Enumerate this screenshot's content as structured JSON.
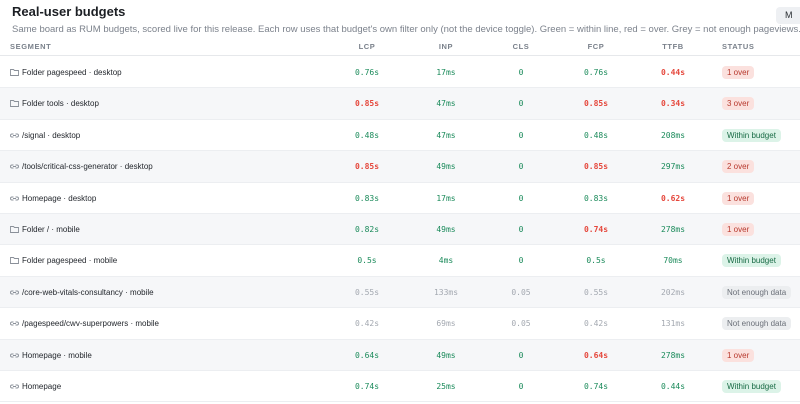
{
  "header": {
    "title": "Real-user budgets",
    "subtitle": "Same board as RUM budgets, scored live for this release. Each row uses that budget's own filter only (not the device toggle). Green = within line, red = over. Grey = not enough pageviews.",
    "corner_button": "M"
  },
  "table": {
    "columns": [
      "SEGMENT",
      "LCP",
      "INP",
      "CLS",
      "FCP",
      "TTFB",
      "STATUS"
    ],
    "rows": [
      {
        "icon": "folder-icon",
        "segment": "Folder pagespeed · desktop",
        "lcp": "0.76s",
        "lcp_s": "good",
        "inp": "17ms",
        "inp_s": "good",
        "cls": "0",
        "cls_s": "good",
        "fcp": "0.76s",
        "fcp_s": "good",
        "ttfb": "0.44s",
        "ttfb_s": "bad",
        "status": "1 over",
        "status_s": "bad"
      },
      {
        "icon": "folder-icon",
        "segment": "Folder tools · desktop",
        "lcp": "0.85s",
        "lcp_s": "bad",
        "inp": "47ms",
        "inp_s": "good",
        "cls": "0",
        "cls_s": "good",
        "fcp": "0.85s",
        "fcp_s": "bad",
        "ttfb": "0.34s",
        "ttfb_s": "bad",
        "status": "3 over",
        "status_s": "bad"
      },
      {
        "icon": "link-icon",
        "segment": "/signal · desktop",
        "lcp": "0.48s",
        "lcp_s": "good",
        "inp": "47ms",
        "inp_s": "good",
        "cls": "0",
        "cls_s": "good",
        "fcp": "0.48s",
        "fcp_s": "good",
        "ttfb": "208ms",
        "ttfb_s": "good",
        "status": "Within budget",
        "status_s": "good"
      },
      {
        "icon": "link-icon",
        "segment": "/tools/critical-css-generator · desktop",
        "lcp": "0.85s",
        "lcp_s": "bad",
        "inp": "49ms",
        "inp_s": "good",
        "cls": "0",
        "cls_s": "good",
        "fcp": "0.85s",
        "fcp_s": "bad",
        "ttfb": "297ms",
        "ttfb_s": "good",
        "status": "2 over",
        "status_s": "bad"
      },
      {
        "icon": "link-icon",
        "segment": "Homepage · desktop",
        "lcp": "0.83s",
        "lcp_s": "good",
        "inp": "17ms",
        "inp_s": "good",
        "cls": "0",
        "cls_s": "good",
        "fcp": "0.83s",
        "fcp_s": "good",
        "ttfb": "0.62s",
        "ttfb_s": "bad",
        "status": "1 over",
        "status_s": "bad"
      },
      {
        "icon": "folder-icon",
        "segment": "Folder / · mobile",
        "lcp": "0.82s",
        "lcp_s": "good",
        "inp": "49ms",
        "inp_s": "good",
        "cls": "0",
        "cls_s": "good",
        "fcp": "0.74s",
        "fcp_s": "bad",
        "ttfb": "278ms",
        "ttfb_s": "good",
        "status": "1 over",
        "status_s": "bad"
      },
      {
        "icon": "folder-icon",
        "segment": "Folder pagespeed · mobile",
        "lcp": "0.5s",
        "lcp_s": "good",
        "inp": "4ms",
        "inp_s": "good",
        "cls": "0",
        "cls_s": "good",
        "fcp": "0.5s",
        "fcp_s": "good",
        "ttfb": "70ms",
        "ttfb_s": "good",
        "status": "Within budget",
        "status_s": "good"
      },
      {
        "icon": "link-icon",
        "segment": "/core-web-vitals-consultancy · mobile",
        "lcp": "0.55s",
        "lcp_s": "none",
        "inp": "133ms",
        "inp_s": "none",
        "cls": "0.05",
        "cls_s": "none",
        "fcp": "0.55s",
        "fcp_s": "none",
        "ttfb": "202ms",
        "ttfb_s": "none",
        "status": "Not enough data",
        "status_s": "none"
      },
      {
        "icon": "link-icon",
        "segment": "/pagespeed/cwv-superpowers · mobile",
        "lcp": "0.42s",
        "lcp_s": "none",
        "inp": "69ms",
        "inp_s": "none",
        "cls": "0.05",
        "cls_s": "none",
        "fcp": "0.42s",
        "fcp_s": "none",
        "ttfb": "131ms",
        "ttfb_s": "none",
        "status": "Not enough data",
        "status_s": "none"
      },
      {
        "icon": "link-icon",
        "segment": "Homepage · mobile",
        "lcp": "0.64s",
        "lcp_s": "good",
        "inp": "49ms",
        "inp_s": "good",
        "cls": "0",
        "cls_s": "good",
        "fcp": "0.64s",
        "fcp_s": "bad",
        "ttfb": "278ms",
        "ttfb_s": "good",
        "status": "1 over",
        "status_s": "bad"
      },
      {
        "icon": "link-icon",
        "segment": "Homepage",
        "lcp": "0.74s",
        "lcp_s": "good",
        "inp": "25ms",
        "inp_s": "good",
        "cls": "0",
        "cls_s": "good",
        "fcp": "0.74s",
        "fcp_s": "good",
        "ttfb": "0.44s",
        "ttfb_s": "good",
        "status": "Within budget",
        "status_s": "good"
      }
    ]
  },
  "colors": {
    "good": "#1a8a5a",
    "bad": "#e5483d",
    "none": "#a3a8b0",
    "alt_row": "#f6f7f9"
  }
}
